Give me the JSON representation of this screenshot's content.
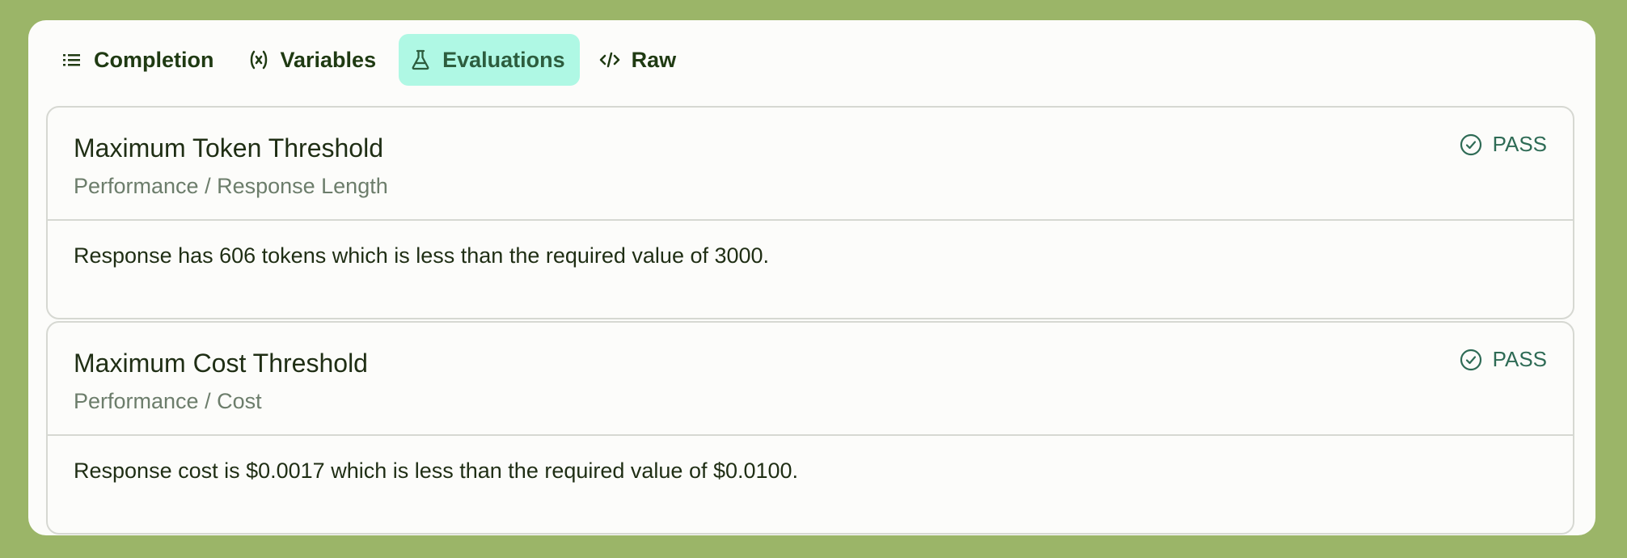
{
  "tabs": [
    {
      "label": "Completion",
      "icon": "list-icon",
      "active": false
    },
    {
      "label": "Variables",
      "icon": "variable-icon",
      "active": false
    },
    {
      "label": "Evaluations",
      "icon": "flask-icon",
      "active": true
    },
    {
      "label": "Raw",
      "icon": "code-icon",
      "active": false
    }
  ],
  "evaluations": [
    {
      "title": "Maximum Token Threshold",
      "category": "Performance / Response Length",
      "status": "PASS",
      "message": "Response has 606 tokens which is less than the required value of 3000."
    },
    {
      "title": "Maximum Cost Threshold",
      "category": "Performance / Cost",
      "status": "PASS",
      "message": "Response cost is $0.0017 which is less than the required value of $0.0100."
    }
  ],
  "colors": {
    "background": "#9bb568",
    "panel": "#fcfcfa",
    "active_tab": "#aff8e4",
    "pass": "#2e6b55"
  }
}
